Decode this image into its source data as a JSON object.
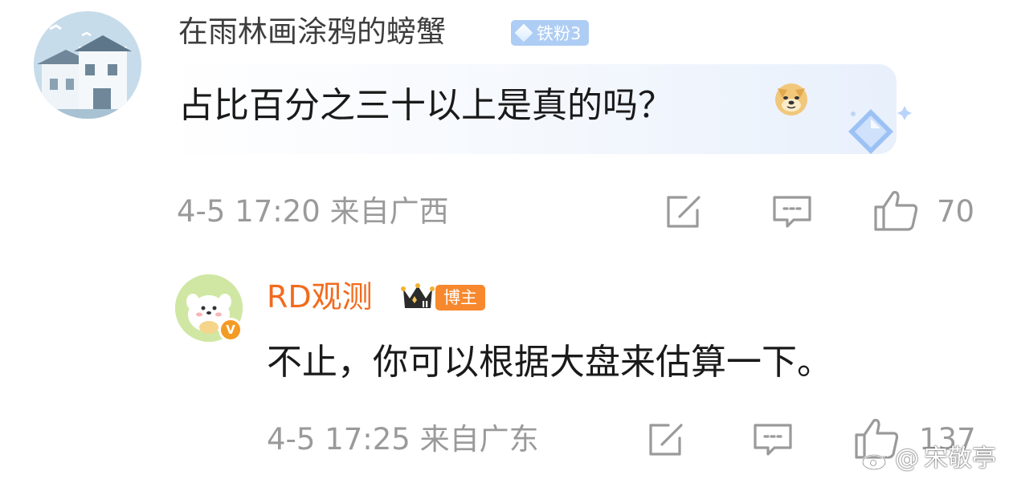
{
  "comments": [
    {
      "username": "在雨林画涂鸦的螃蟹",
      "badge": "铁粉3",
      "text": "占比百分之三十以上是真的吗？",
      "emoji": "doge-emoji",
      "time": "4-5 17:20",
      "location": "来自广西",
      "likes": "70",
      "colors": {
        "username": "#3d3d3d",
        "badge_bg": "#aecdf4"
      }
    },
    {
      "username": "RD观测",
      "badge": "博主",
      "verified_mark": "V",
      "text": "不止，你可以根据大盘来估算一下。",
      "time": "4-5 17:25",
      "location": "来自广东",
      "likes": "137",
      "colors": {
        "username": "#f26b1d",
        "badge_bg": "#f7882d"
      }
    }
  ],
  "icons": {
    "edit": "edit-icon",
    "comment": "comment-icon",
    "like": "thumbs-up-icon"
  },
  "watermark": {
    "at": "@",
    "text": "宋敬亭"
  },
  "colors": {
    "meta_text": "#9a9a9a",
    "body_text": "#1a1a1a"
  }
}
